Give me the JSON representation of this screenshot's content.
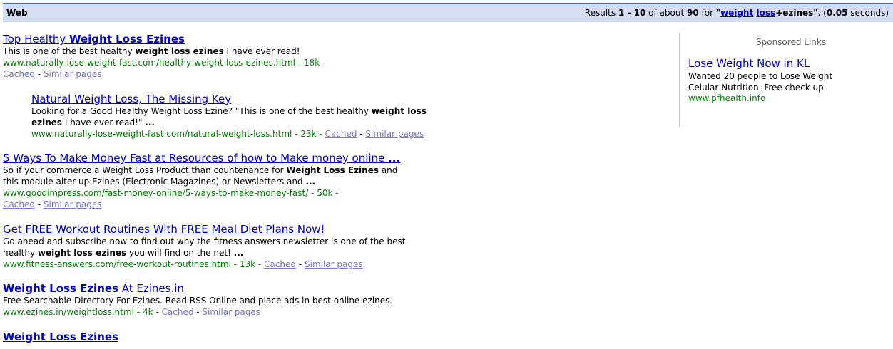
{
  "bar": {
    "web_label": "Web",
    "stats_prefix": "Results ",
    "range_start": "1",
    "range_sep": " - ",
    "range_end": "10",
    "of_about": " of about ",
    "total": "90",
    "for_word": " for ",
    "query_open": "\"",
    "query_term1": "weight",
    "query_space": " ",
    "query_term2": "loss",
    "query_rest": "+ezines\"",
    "time_text": ". (",
    "time_value": "0.05",
    "time_suffix": " seconds)"
  },
  "results": [
    {
      "title_pre": "Top Healthy ",
      "title_bold": "Weight Loss Ezines",
      "title_post": "",
      "snippet_pre": "This is one of the best healthy ",
      "snippet_bold": "weight loss ezines",
      "snippet_post": " I have ever read!",
      "url": "www.naturally-lose-weight-fast.com/healthy-weight-loss-ezines.html - 18k -",
      "cached": "Cached",
      "sep": " - ",
      "similar": "Similar pages"
    },
    {
      "title_pre": "Natural Weight Loss, The Missing Key",
      "snippet_line1_pre": "Looking for a Good Healthy Weight Loss Ezine? \"This is one of the best healthy ",
      "snippet_line1_bold": "weight loss",
      "snippet_line2_bold": "ezines",
      "snippet_line2_post": " I have ever read!\" ",
      "snippet_line2_ellipsis": "...",
      "url": "www.naturally-lose-weight-fast.com/natural-weight-loss.html - 23k - ",
      "cached": "Cached",
      "sep": " - ",
      "similar": "Similar pages"
    },
    {
      "title_pre": "5 Ways To Make Money Fast at Resources of how to Make money online ",
      "title_ellipsis": "...",
      "snippet_line1_pre": "So if your commerce a Weight Loss Product than countenance for ",
      "snippet_line1_bold": "Weight Loss Ezines",
      "snippet_line1_post": " and",
      "snippet_line2_pre": "this module alter up Ezines (Electronic Magazines) or Newsletters and ",
      "snippet_line2_ellipsis": "...",
      "url": "www.goodimpress.com/fast-money-online/5-ways-to-make-money-fast/ - 50k -",
      "cached": "Cached",
      "sep": " - ",
      "similar": "Similar pages"
    },
    {
      "title_pre": "Get FREE Workout Routines With FREE Meal Diet Plans Now!",
      "snippet_line1_pre": "Go ahead and subscribe now to find out why the fitness answers newsletter is one of the best",
      "snippet_line2_pre": "healthy ",
      "snippet_line2_bold": "weight loss ezines",
      "snippet_line2_post": " you will find on the net! ",
      "snippet_line2_ellipsis": "...",
      "url": "www.fitness-answers.com/free-workout-routines.html - 13k - ",
      "cached": "Cached",
      "sep": " - ",
      "similar": "Similar pages"
    },
    {
      "title_bold": "Weight Loss Ezines",
      "title_post": " At Ezines.in",
      "snippet_pre": "Free Searchable Directory For Ezines. Read RSS Online and place ads in best online ezines.",
      "url": "www.ezines.in/weightloss.html - 4k - ",
      "cached": "Cached",
      "sep": " - ",
      "similar": "Similar pages"
    },
    {
      "title_bold": "Weight Loss Ezines"
    }
  ],
  "ads": {
    "header": "Sponsored Links",
    "title": "Lose Weight Now in KL",
    "text": "Wanted 20 people to Lose Weight Celular Nutrition. Free check up",
    "url": "www.pfhealth.info"
  },
  "colors": {
    "link": "#0000cc",
    "url_green": "#008000",
    "bar_bg": "#d5ddf3",
    "bar_line": "#3366cc",
    "secondary_link": "#7777cc"
  }
}
